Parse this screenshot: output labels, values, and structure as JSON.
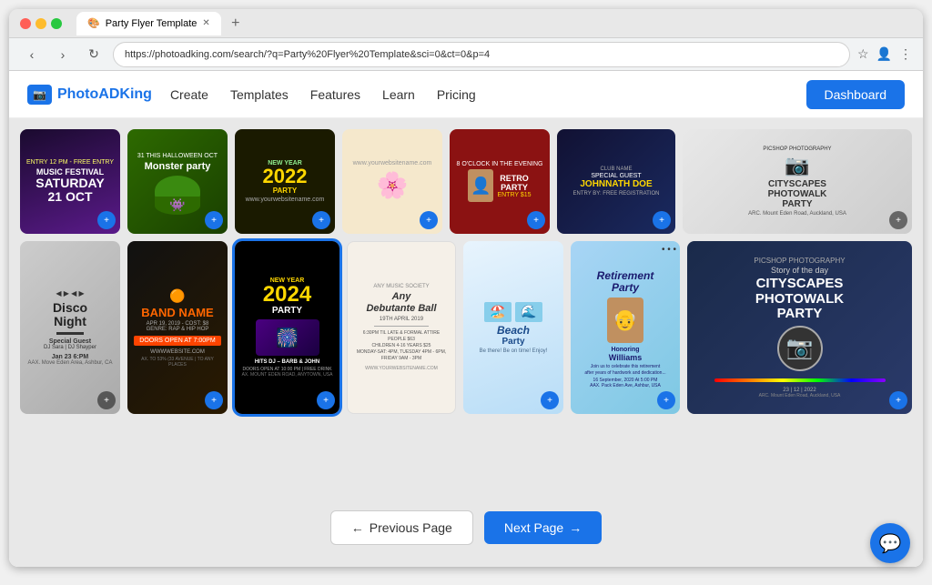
{
  "browser": {
    "url": "https://photoadking.com/search/?q=Party%20Flyer%20Template&sci=0&ct=0&p=4",
    "tab_title": "Party Flyer Template",
    "favicon": "🎨"
  },
  "nav": {
    "logo_text": "PhotoADK",
    "logo_suffix": "ing",
    "links": [
      "Create",
      "Templates",
      "Features",
      "Learn",
      "Pricing"
    ],
    "dashboard_label": "Dashboard"
  },
  "gallery": {
    "templates": [
      {
        "id": 1,
        "title": "MUSIC FESTIVAL",
        "subtitle": "SATURDAY 21 OCT",
        "bg": "#1a0a2e",
        "text_color": "#ffffff"
      },
      {
        "id": 2,
        "title": "Monster party",
        "subtitle": "31 THIS HALLOWEEN OCT",
        "bg": "#2d6a00",
        "text_color": "#ffffff"
      },
      {
        "id": 3,
        "title": "NEW YEAR 2022 PARTY",
        "subtitle": "",
        "bg": "#1a1a00",
        "text_color": "#ffd700"
      },
      {
        "id": 4,
        "title": "",
        "subtitle": "",
        "bg": "#f5e8cc",
        "text_color": "#333"
      },
      {
        "id": 5,
        "title": "RETRO PARTY",
        "subtitle": "ENTRY $15",
        "bg": "#8b1212",
        "text_color": "#ffffff"
      },
      {
        "id": 6,
        "title": "JOHNNATH DOE",
        "subtitle": "SPECIAL GUEST",
        "bg": "#111133",
        "text_color": "#ffffff"
      },
      {
        "id": 7,
        "title": "DISCO Night",
        "subtitle": "Special Guest DJ Sara",
        "bg": "#cccccc",
        "text_color": "#222"
      },
      {
        "id": 8,
        "title": "BAND NAME",
        "subtitle": "DOORS OPEN AT 7:00PM",
        "bg": "#111111",
        "text_color": "#ff6600"
      },
      {
        "id": 9,
        "title": "2024 PARTY",
        "subtitle": "NEW YEAR HITS DJ BARB & JOHN",
        "bg": "#000000",
        "text_color": "#ffd700",
        "selected": true
      },
      {
        "id": 10,
        "title": "Any Debutante Ball",
        "subtitle": "19TH APRIL 2019",
        "bg": "#f5f0e8",
        "text_color": "#333"
      },
      {
        "id": 11,
        "title": "Retirement Party",
        "subtitle": "Honoring Williams",
        "bg": "#87ceeb",
        "text_color": "#1a1a6e"
      },
      {
        "id": 12,
        "title": "PICSHOP PHOTOGRAPHY CITYSCAPES PHOTOWALK PARTY",
        "subtitle": "",
        "bg": "#1a2a4a",
        "text_color": "#ffffff"
      }
    ]
  },
  "pagination": {
    "prev_label": "Previous Page",
    "next_label": "Next Page",
    "prev_icon": "←",
    "next_icon": "→"
  },
  "chat": {
    "icon": "💬"
  }
}
